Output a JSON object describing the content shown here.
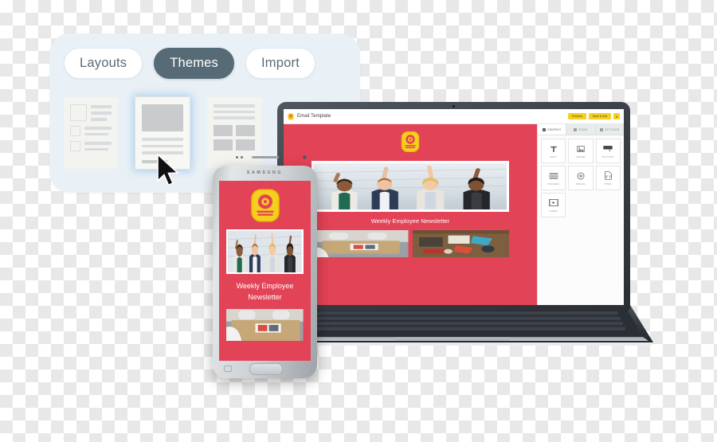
{
  "panel": {
    "tabs": [
      {
        "label": "Layouts",
        "active": false
      },
      {
        "label": "Themes",
        "active": true
      },
      {
        "label": "Import",
        "active": false
      }
    ],
    "thumbnails": [
      {
        "name": "layout-list-template",
        "selected": false
      },
      {
        "name": "layout-hero-template",
        "selected": true
      },
      {
        "name": "layout-grid-template",
        "selected": false
      }
    ]
  },
  "editor": {
    "app_title": "Email Template",
    "preview_label": "Preview",
    "save_label": "Save & exit",
    "caret_label": "▾",
    "tool_tabs": [
      {
        "label": "CONTENT",
        "active": true
      },
      {
        "label": "ROWS",
        "active": false
      },
      {
        "label": "SETTINGS",
        "active": false
      }
    ],
    "tools": [
      {
        "label": "TEXT",
        "icon": "text-icon"
      },
      {
        "label": "IMAGE",
        "icon": "image-icon"
      },
      {
        "label": "BUTTON",
        "icon": "button-icon"
      },
      {
        "label": "DIVIDER",
        "icon": "divider-icon"
      },
      {
        "label": "SOCIAL",
        "icon": "social-icon"
      },
      {
        "label": "HTML",
        "icon": "html-icon"
      },
      {
        "label": "VIDEO",
        "icon": "video-icon"
      }
    ]
  },
  "newsletter": {
    "headline": "Weekly Employee Newsletter",
    "logo_name": "company-badge-logo",
    "hero_alt": "four-cheering-colleagues-photo",
    "thumb_left_alt": "office-desk-photo",
    "thumb_right_alt": "craft-table-photo"
  },
  "phone": {
    "brand": "SAMSUNG",
    "headline_line1": "Weekly Employee",
    "headline_line2": "Newsletter"
  },
  "colors": {
    "brand_red": "#e34356",
    "accent_yellow": "#f5cf1d",
    "tab_active": "#566b76",
    "panel_bg": "#eaf1f6"
  }
}
